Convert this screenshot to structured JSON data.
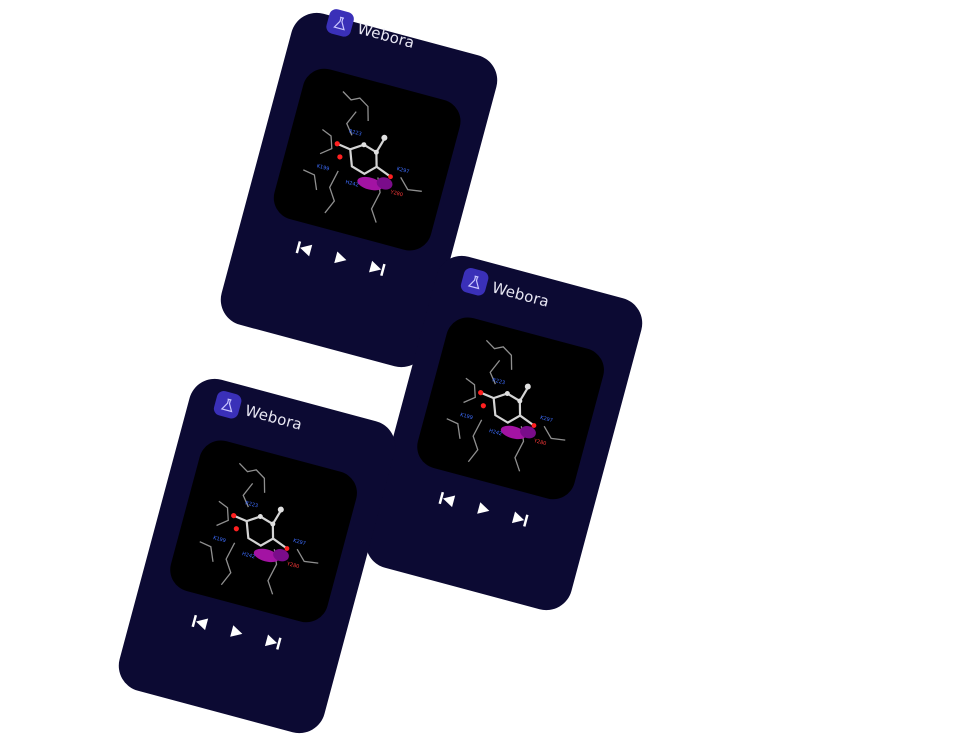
{
  "brand": {
    "name": "Webora",
    "logo_icon": "flask-icon",
    "accent": "#3a30b8"
  },
  "card_background": "#0c0a33",
  "artwork": {
    "labels": [
      "R223",
      "K297",
      "K199",
      "H242",
      "Y280"
    ],
    "label_colors": {
      "blue": "#3d6dff",
      "red": "#ff2a2a",
      "magenta": "#b01fb0"
    }
  },
  "controls": {
    "previous_icon": "skip-previous-icon",
    "play_icon": "play-icon",
    "next_icon": "skip-next-icon"
  }
}
